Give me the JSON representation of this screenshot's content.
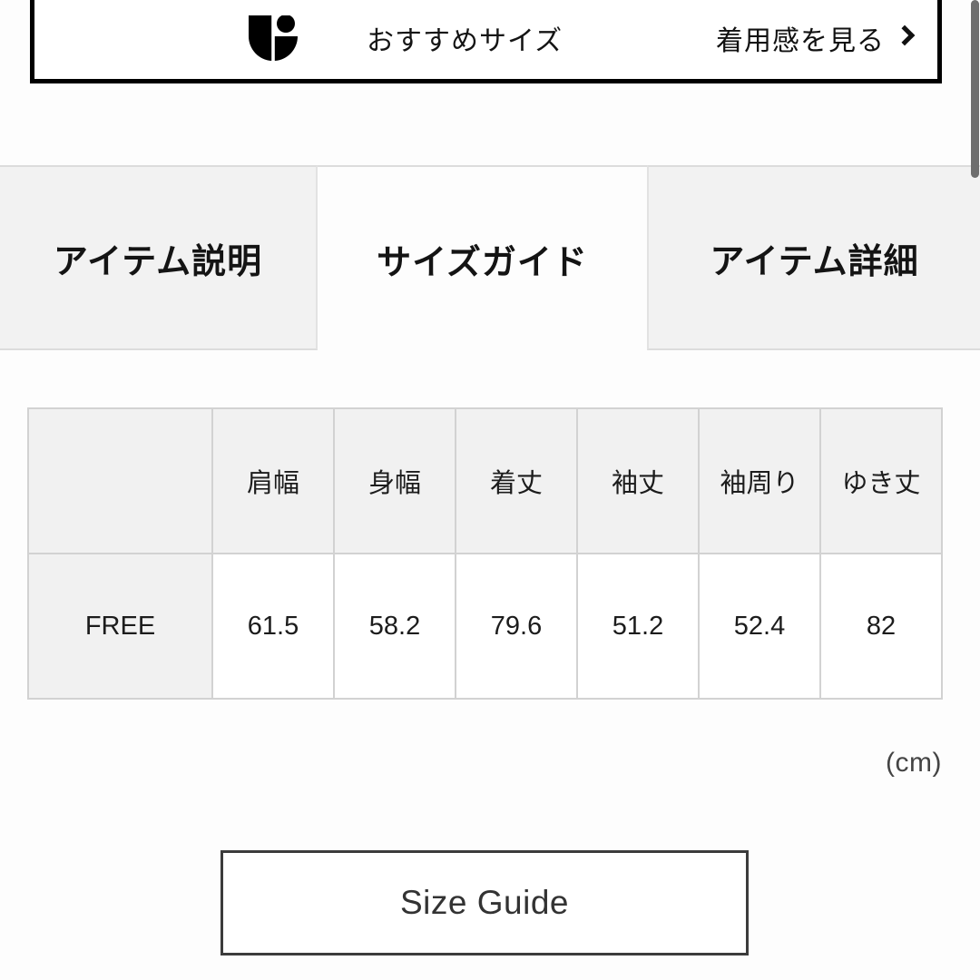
{
  "promo": {
    "icon_name": "body-measure-icon",
    "label": "おすすめサイズ",
    "link_label": "着用感を見る",
    "chevron_icon": "chevron-right-icon",
    "border_color": "#000000"
  },
  "tabs": [
    {
      "label": "アイテム説明",
      "active": false
    },
    {
      "label": "サイズガイド",
      "active": true
    },
    {
      "label": "アイテム詳細",
      "active": false
    }
  ],
  "size_table": {
    "headers": [
      "",
      "肩幅",
      "身幅",
      "着丈",
      "袖丈",
      "袖周り",
      "ゆき丈"
    ],
    "rows": [
      {
        "size": "FREE",
        "values": [
          "61.5",
          "58.2",
          "79.6",
          "51.2",
          "52.4",
          "82"
        ]
      }
    ],
    "unit_note": "(cm)"
  },
  "size_guide_button": {
    "label": "Size Guide"
  },
  "colors": {
    "tab_inactive_bg": "#f2f2f2",
    "tab_active_bg": "#fdfdfd",
    "table_header_bg": "#f1f1f1",
    "table_border": "#d2d2d2",
    "text": "#141414",
    "scrollbar_thumb": "#6e6e6e"
  }
}
